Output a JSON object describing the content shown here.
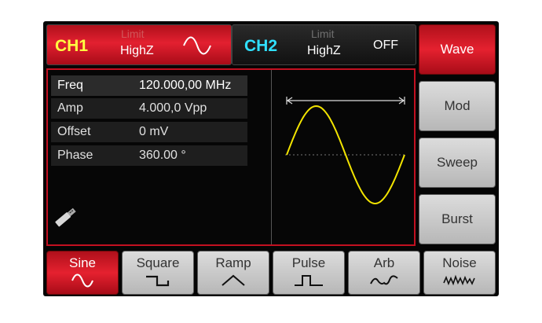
{
  "ch1": {
    "name": "CH1",
    "limit": "Limit",
    "impedance": "HighZ",
    "wave_icon": "sine-icon"
  },
  "ch2": {
    "name": "CH2",
    "limit": "Limit",
    "impedance": "HighZ",
    "state": "OFF"
  },
  "menu": [
    "Wave",
    "Mod",
    "Sweep",
    "Burst"
  ],
  "params": [
    {
      "label": "Freq",
      "value": "120.000,00 MHz"
    },
    {
      "label": "Amp",
      "value": "4.000,0 Vpp"
    },
    {
      "label": "Offset",
      "value": "0 mV"
    },
    {
      "label": "Phase",
      "value": "360.00 °"
    }
  ],
  "waves": [
    {
      "label": "Sine",
      "icon": "sine-icon"
    },
    {
      "label": "Square",
      "icon": "square-wave-icon"
    },
    {
      "label": "Ramp",
      "icon": "ramp-wave-icon"
    },
    {
      "label": "Pulse",
      "icon": "pulse-wave-icon"
    },
    {
      "label": "Arb",
      "icon": "arb-wave-icon"
    },
    {
      "label": "Noise",
      "icon": "noise-wave-icon"
    }
  ],
  "colors": {
    "accent_red": "#e32030",
    "ch1_yellow": "#ffff40",
    "ch2_cyan": "#30e0ff",
    "trace_yellow": "#f2e400"
  },
  "active": {
    "menu": "Wave",
    "wave": "Sine",
    "param": "Freq"
  }
}
